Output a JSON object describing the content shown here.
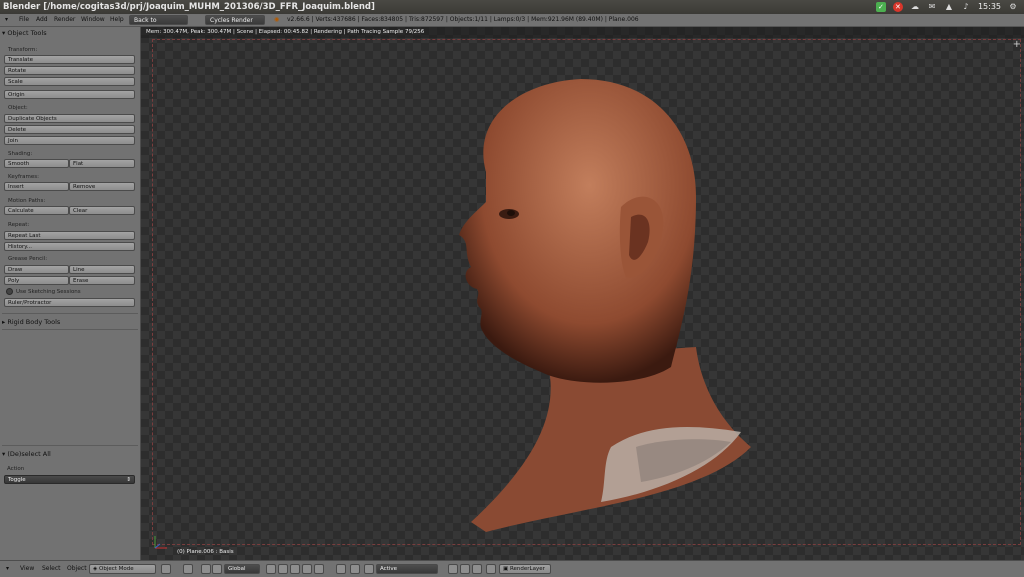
{
  "window": {
    "title": "Blender [/home/cogitas3d/prj/Joaquim_MUHM_201306/3D_FFR_Joaquim.blend]",
    "clock": "15:35"
  },
  "menu": {
    "items": [
      "File",
      "Add",
      "Render",
      "Window",
      "Help"
    ],
    "back_button": "Back to Previous",
    "engine": "Cycles Render",
    "stats": "v2.66.6 | Verts:437686 | Faces:834805 | Tris:872597 | Objects:1/11 | Lamps:0/3 | Mem:921.96M (89.40M) | Plane.006"
  },
  "toolshelf": {
    "header": "Object Tools",
    "transform_label": "Transform:",
    "translate": "Translate",
    "rotate": "Rotate",
    "scale": "Scale",
    "origin": "Origin",
    "object_label": "Object:",
    "duplicate": "Duplicate Objects",
    "delete": "Delete",
    "join": "Join",
    "shading_label": "Shading:",
    "smooth": "Smooth",
    "flat": "Flat",
    "keyframes_label": "Keyframes:",
    "insert": "Insert",
    "remove": "Remove",
    "motion_label": "Motion Paths:",
    "calculate": "Calculate",
    "clear": "Clear",
    "repeat_label": "Repeat:",
    "repeat_last": "Repeat Last",
    "history": "History...",
    "grease_label": "Grease Pencil:",
    "draw": "Draw",
    "line": "Line",
    "poly": "Poly",
    "erase": "Erase",
    "sketching": "Use Sketching Sessions",
    "ruler": "Ruler/Protractor",
    "rigid_body": "Rigid Body Tools",
    "operator_header": "(De)select All",
    "action_label": "Action",
    "action_value": "Toggle"
  },
  "viewport": {
    "render_status": "Mem: 300.47M, Peak: 300.47M | Scene | Elapsed: 00:45.82 | Rendering | Path Tracing Sample 79/256",
    "object_label": "(0) Plane.006 : Basis"
  },
  "bottombar": {
    "view": "View",
    "select": "Select",
    "object": "Object",
    "mode": "Object Mode",
    "orientation": "Global",
    "layer_dropdown": "Active",
    "render_layer": "RenderLayer"
  },
  "colors": {
    "panel_gray": "#727272",
    "viewport_dark": "#363636",
    "skin": "#b06a4a"
  }
}
